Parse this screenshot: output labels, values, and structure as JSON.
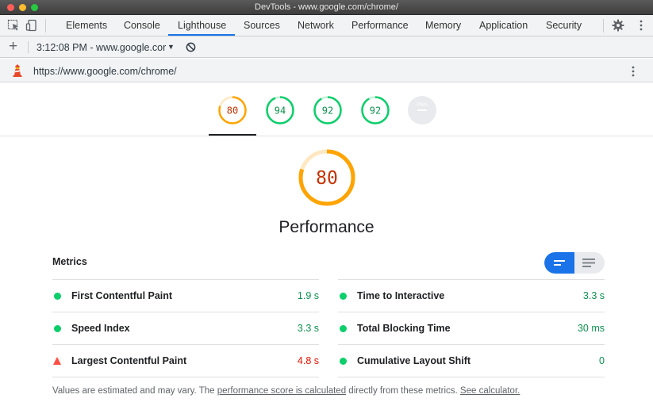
{
  "window": {
    "title": "DevTools - www.google.com/chrome/"
  },
  "tabs": [
    {
      "label": "Elements"
    },
    {
      "label": "Console"
    },
    {
      "label": "Lighthouse"
    },
    {
      "label": "Sources"
    },
    {
      "label": "Network"
    },
    {
      "label": "Performance"
    },
    {
      "label": "Memory"
    },
    {
      "label": "Application"
    },
    {
      "label": "Security"
    }
  ],
  "active_tab": "Lighthouse",
  "report": {
    "selector": "3:12:08 PM - www.google.cor",
    "dropdown_arrow": "▼",
    "add": "+"
  },
  "url": "https://www.google.com/chrome/",
  "categories": [
    {
      "score": "80",
      "color": "#ffa400",
      "fill": 0.8
    },
    {
      "score": "94",
      "color": "#0cce6b",
      "fill": 0.94
    },
    {
      "score": "92",
      "color": "#0cce6b",
      "fill": 0.92
    },
    {
      "score": "92",
      "color": "#0cce6b",
      "fill": 0.92
    },
    {
      "score": "PWA",
      "color": "#9aa0a6",
      "fill": 0
    }
  ],
  "performance": {
    "score": "80",
    "title": "Performance",
    "fill": 0.8,
    "color": "#ffa400"
  },
  "metrics": {
    "label": "Metrics",
    "left": [
      {
        "name": "First Contentful Paint",
        "value": "1.9 s",
        "status": "pass"
      },
      {
        "name": "Speed Index",
        "value": "3.3 s",
        "status": "pass"
      },
      {
        "name": "Largest Contentful Paint",
        "value": "4.8 s",
        "status": "fail"
      }
    ],
    "right": [
      {
        "name": "Time to Interactive",
        "value": "3.3 s",
        "status": "pass"
      },
      {
        "name": "Total Blocking Time",
        "value": "30 ms",
        "status": "pass"
      },
      {
        "name": "Cumulative Layout Shift",
        "value": "0",
        "status": "pass"
      }
    ]
  },
  "footer": {
    "text1": "Values are estimated and may vary. The ",
    "link1": "performance score is calculated",
    "text2": " directly from these metrics. ",
    "link2": "See calculator."
  },
  "colors": {
    "pass": "#0cce6b",
    "pass_text": "#0d904f",
    "average": "#ffa400",
    "average_text": "#c33300",
    "fail": "#ff4e42",
    "fail_text": "#eb0f00",
    "accent": "#1a73e8"
  }
}
